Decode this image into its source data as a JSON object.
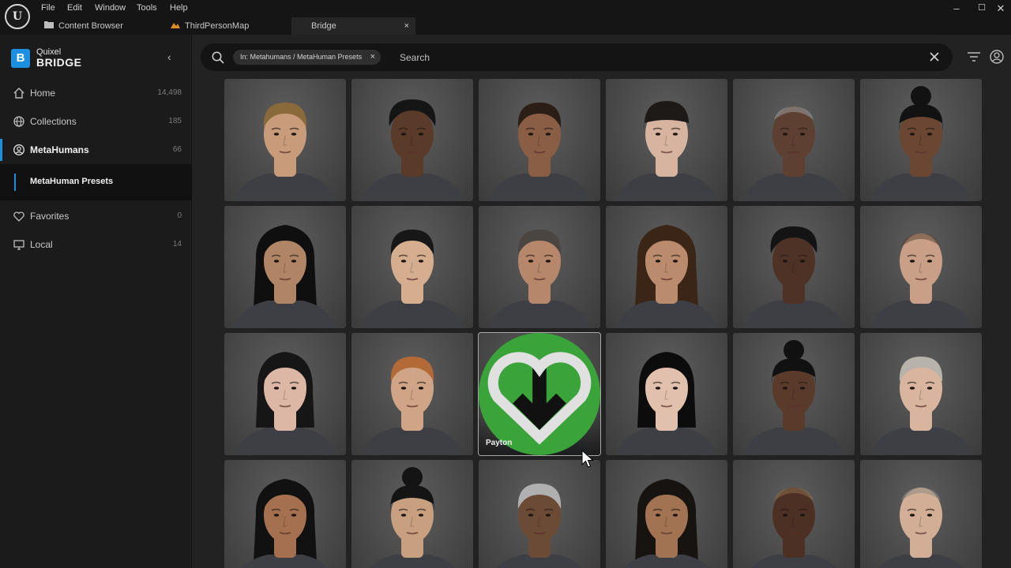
{
  "app": {
    "logo_text": "U",
    "menu": [
      "File",
      "Edit",
      "Window",
      "Tools",
      "Help"
    ],
    "window_controls": {
      "minimize": "–",
      "maximize": "☐",
      "close": "✕"
    }
  },
  "tabs": [
    {
      "label": "Content Browser",
      "icon": "folder-icon",
      "active": false
    },
    {
      "label": "ThirdPersonMap",
      "icon": "level-icon",
      "active": false
    },
    {
      "label": "Bridge",
      "icon": "",
      "active": true,
      "close": "×"
    }
  ],
  "sidebar": {
    "brand_line1": "Quixel",
    "brand_line2": "BRIDGE",
    "brand_letter": "B",
    "collapse_glyph": "‹",
    "items": [
      {
        "label": "Home",
        "count": "14,498",
        "icon": "home-icon"
      },
      {
        "label": "Collections",
        "count": "185",
        "icon": "globe-icon"
      },
      {
        "label": "MetaHumans",
        "count": "66",
        "icon": "user-circle-icon",
        "active": true
      },
      {
        "label": "Favorites",
        "count": "0",
        "icon": "heart-icon"
      },
      {
        "label": "Local",
        "count": "14",
        "icon": "monitor-icon"
      }
    ],
    "sub_item": "MetaHuman Presets"
  },
  "search": {
    "chip": "In: Metahumans / MetaHuman Presets",
    "chip_close": "×",
    "placeholder": "Search"
  },
  "grid": {
    "hovered_name": "Payton",
    "colors": {
      "accent": "#1d8fe0",
      "download": "#3aa33a",
      "card_bg": "#4a4a4a"
    },
    "cards": [
      {
        "skin": "#c89b7b",
        "hair": "#8a6a3a",
        "style": "short"
      },
      {
        "skin": "#5a3a28",
        "hair": "#151515",
        "style": "curly"
      },
      {
        "skin": "#8a5e45",
        "hair": "#2a1e16",
        "style": "braids"
      },
      {
        "skin": "#d7b4a0",
        "hair": "#1e1a17",
        "style": "bangs"
      },
      {
        "skin": "#5e4033",
        "hair": "#9a9a9a",
        "style": "bald"
      },
      {
        "skin": "#6b4632",
        "hair": "#121212",
        "style": "bun"
      },
      {
        "skin": "#b08565",
        "hair": "#0f0f0f",
        "style": "long"
      },
      {
        "skin": "#d5ae90",
        "hair": "#171717",
        "style": "short"
      },
      {
        "skin": "#b6876b",
        "hair": "#4b4541",
        "style": "short"
      },
      {
        "skin": "#bb8b6d",
        "hair": "#3a2516",
        "style": "long"
      },
      {
        "skin": "#4e3226",
        "hair": "#141414",
        "style": "curly"
      },
      {
        "skin": "#c9a087",
        "hair": "#5b4535",
        "style": "bald"
      },
      {
        "skin": "#dcb7a6",
        "hair": "#161616",
        "style": "bob"
      },
      {
        "skin": "#d0a486",
        "hair": "#b36a36",
        "style": "short"
      },
      {
        "skin": "#d9b8a5",
        "hair": "#1b1512",
        "style": "bun",
        "name": "Payton",
        "hover": true
      },
      {
        "skin": "#e2c0ae",
        "hair": "#0c0c0c",
        "style": "bob"
      },
      {
        "skin": "#5a3a2b",
        "hair": "#111111",
        "style": "bun"
      },
      {
        "skin": "#d9b59f",
        "hair": "#b7b2aa",
        "style": "short"
      },
      {
        "skin": "#a5704f",
        "hair": "#111111",
        "style": "long"
      },
      {
        "skin": "#c8a07f",
        "hair": "#141414",
        "style": "bun"
      },
      {
        "skin": "#6b4a36",
        "hair": "#b0b0b0",
        "style": "short"
      },
      {
        "skin": "#a27352",
        "hair": "#171310",
        "style": "long"
      },
      {
        "skin": "#4d3024",
        "hair": "#8c6e4f",
        "style": "bald"
      },
      {
        "skin": "#d2ae96",
        "hair": "#8f8a84",
        "style": "bald"
      }
    ]
  }
}
